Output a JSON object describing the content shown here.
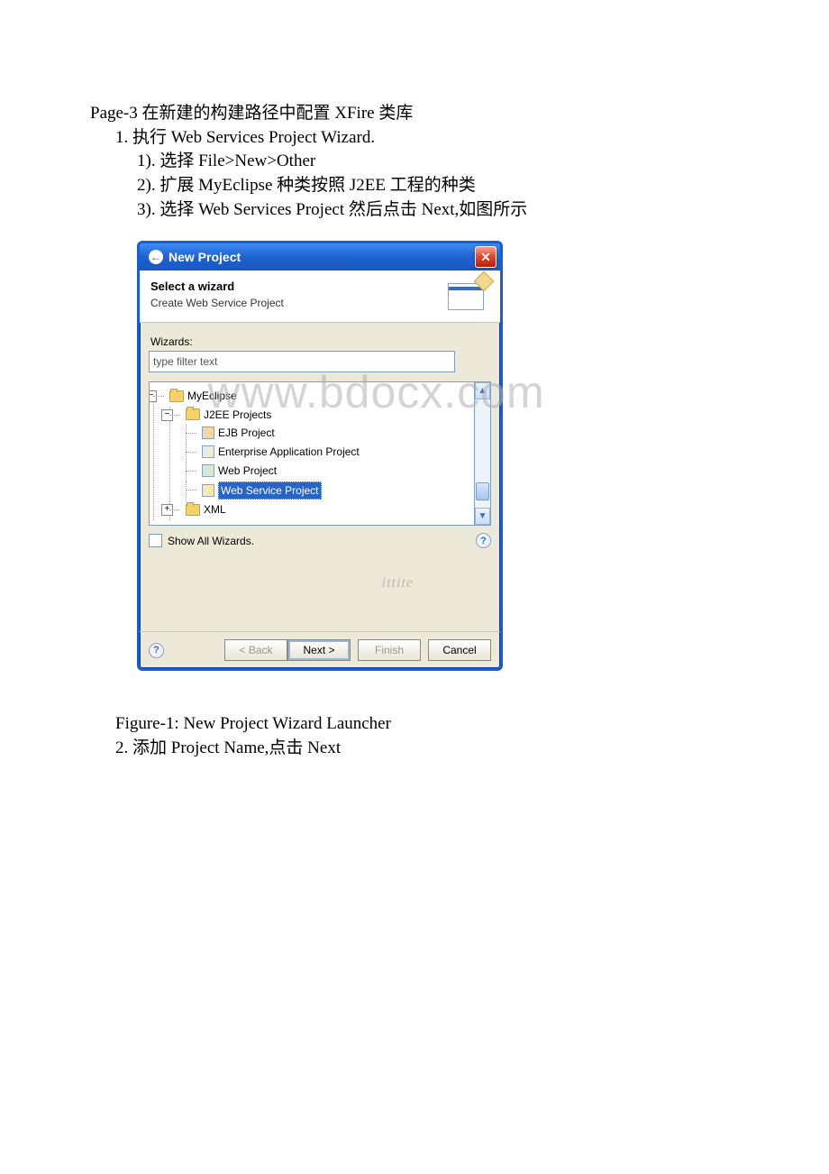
{
  "doc": {
    "page_heading": "Page-3 在新建的构建路径中配置 XFire 类库",
    "step1": "1. 执行 Web Services Project Wizard.",
    "step1_1": "1). 选择 File>New>Other",
    "step1_2": "2). 扩展 MyEclipse 种类按照 J2EE 工程的种类",
    "step1_3": "3). 选择 Web Services Project 然后点击 Next,如图所示",
    "figure_caption": "Figure-1: New Project Wizard Launcher",
    "step2": "2. 添加 Project Name,点击 Next"
  },
  "dialog": {
    "title": "New Project",
    "header_title": "Select a wizard",
    "header_subtitle": "Create Web Service Project",
    "wizards_label": "Wizards:",
    "filter_placeholder": "type filter text",
    "show_all_label": "Show All Wizards.",
    "buttons": {
      "back": "< Back",
      "next": "Next >",
      "finish": "Finish",
      "cancel": "Cancel"
    }
  },
  "tree": {
    "root": "MyEclipse",
    "group": "J2EE Projects",
    "items": [
      "EJB Project",
      "Enterprise Application Project",
      "Web Project",
      "Web Service Project"
    ],
    "selected_index": 3,
    "xml": "XML"
  },
  "watermark": {
    "main": "www.bdocx.com",
    "sub": "ittite"
  }
}
